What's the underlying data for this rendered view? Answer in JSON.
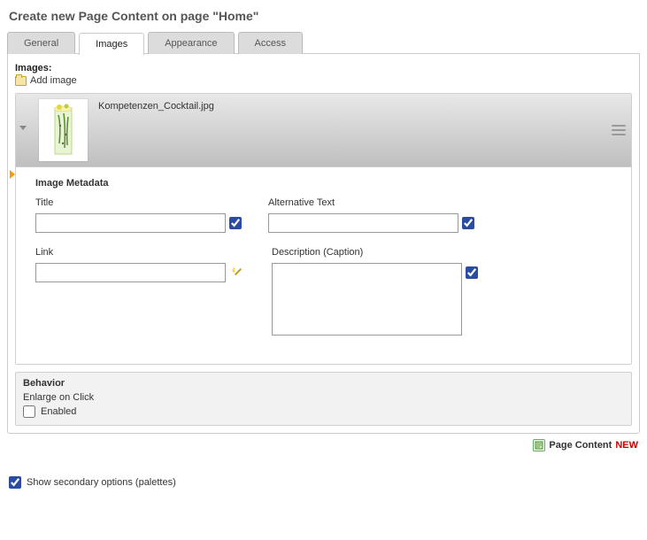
{
  "page_title": "Create new Page Content on page \"Home\"",
  "tabs": {
    "general": "General",
    "images": "Images",
    "appearance": "Appearance",
    "access": "Access"
  },
  "images_section": {
    "label": "Images:",
    "add_label": "Add image"
  },
  "image_item": {
    "filename": "Kompetenzen_Cocktail.jpg"
  },
  "metadata": {
    "heading": "Image Metadata",
    "title_label": "Title",
    "title_value": "",
    "alt_label": "Alternative Text",
    "alt_value": "",
    "link_label": "Link",
    "link_value": "",
    "desc_label": "Description (Caption)",
    "desc_value": ""
  },
  "behavior": {
    "heading": "Behavior",
    "enlarge_label": "Enlarge on Click",
    "enabled_label": "Enabled"
  },
  "footer": {
    "content_type": "Page Content",
    "new_badge": "NEW"
  },
  "secondary_label": "Show secondary options (palettes)"
}
